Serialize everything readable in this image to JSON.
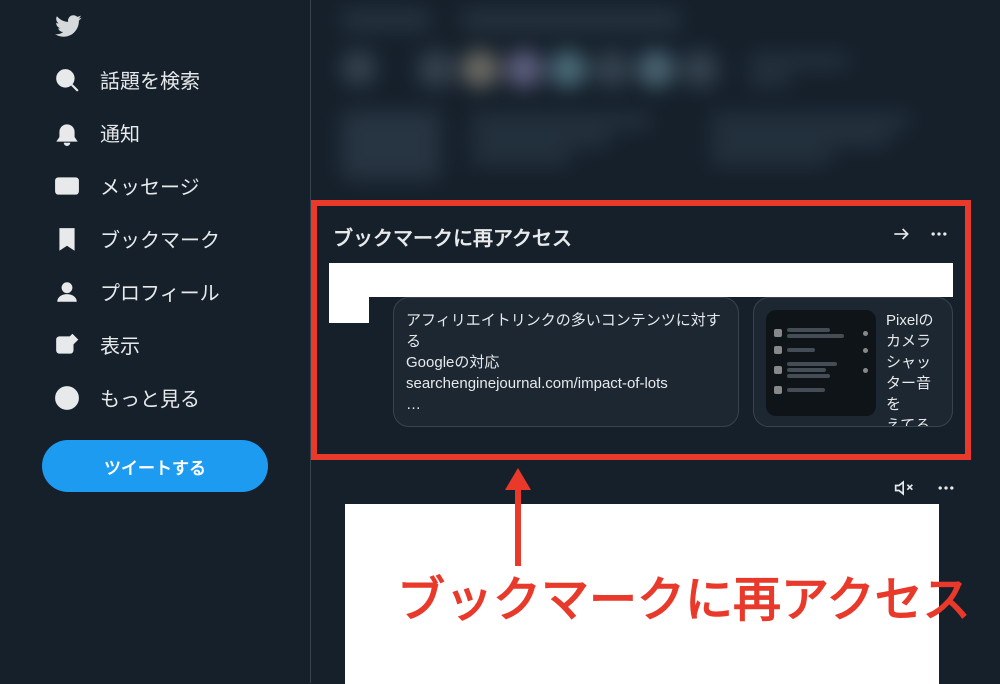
{
  "sidebar": {
    "items": [
      {
        "label": "話題を検索",
        "name": "sidebar-item-explore",
        "icon": "search"
      },
      {
        "label": "通知",
        "name": "sidebar-item-notifications",
        "icon": "bell"
      },
      {
        "label": "メッセージ",
        "name": "sidebar-item-messages",
        "icon": "envelope"
      },
      {
        "label": "ブックマーク",
        "name": "sidebar-item-bookmarks",
        "icon": "bookmark"
      },
      {
        "label": "プロフィール",
        "name": "sidebar-item-profile",
        "icon": "profile"
      },
      {
        "label": "表示",
        "name": "sidebar-item-display",
        "icon": "edit"
      },
      {
        "label": "もっと見る",
        "name": "sidebar-item-more",
        "icon": "more"
      }
    ],
    "tweet_button": "ツイートする"
  },
  "bookmark_widget": {
    "title": "ブックマークに再アクセス",
    "cards": [
      {
        "line1": "アフィリエイトリンクの多いコンテンツに対する",
        "line2": "Googleの対応",
        "line3": "searchenginejournal.com/impact-of-lots",
        "line4": "…"
      },
      {
        "line1": "Pixelのカメラ",
        "line2": "シャッター音を",
        "line3": "えてる（無効"
      }
    ]
  },
  "annotation": {
    "text": "ブックマークに再アクセス"
  }
}
